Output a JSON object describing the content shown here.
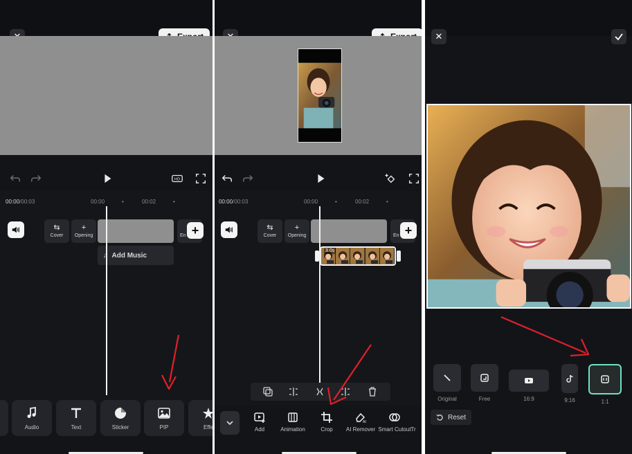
{
  "panel1": {
    "export_label": "Export",
    "timecode_current": "00:00",
    "timecode_total": "/00:03",
    "ticks": [
      "00:00",
      "•",
      "00:02",
      "•"
    ],
    "cover_label": "Cover",
    "opening_label": "Opening",
    "end_label": "En",
    "add_music_label": "Add Music",
    "tools": [
      {
        "label": "Audio",
        "icon": "music-note-icon"
      },
      {
        "label": "Text",
        "icon": "text-icon"
      },
      {
        "label": "Sticker",
        "icon": "sticker-icon"
      },
      {
        "label": "PIP",
        "icon": "pip-image-icon"
      },
      {
        "label": "Effe",
        "icon": "effects-star-icon"
      }
    ]
  },
  "panel2": {
    "export_label": "Export",
    "timecode_current": "00:00",
    "timecode_total": "/00:03",
    "ticks": [
      "00:00",
      "•",
      "00:02",
      "•"
    ],
    "cover_label": "Cover",
    "opening_label": "Opening",
    "end_label": "En",
    "clip_duration": "3.0s",
    "edit_tools": [
      {
        "label": "Add",
        "icon": "add-clip-icon"
      },
      {
        "label": "Animation",
        "icon": "animation-icon"
      },
      {
        "label": "Crop",
        "icon": "crop-icon"
      },
      {
        "label": "AI Remover",
        "icon": "ai-eraser-icon"
      },
      {
        "label": "Smart Cutout",
        "icon": "smart-cutout-icon"
      },
      {
        "label": "Tr",
        "icon": "transform-icon"
      }
    ]
  },
  "panel3": {
    "ratios": [
      {
        "label": "Original",
        "icon": "original-ratio-icon"
      },
      {
        "label": "Free",
        "icon": "free-ratio-icon"
      },
      {
        "label": "16:9",
        "icon": "youtube-icon"
      },
      {
        "label": "9:16",
        "icon": "tiktok-icon"
      },
      {
        "label": "1:1",
        "icon": "square-ratio-icon"
      }
    ],
    "active_ratio": "1:1",
    "reset_label": "Reset"
  },
  "colors": {
    "background": "#131418",
    "accent_active": "#6fe2c1",
    "annotation_arrow": "#e0202a",
    "preview_grey": "#8f8f8f"
  }
}
